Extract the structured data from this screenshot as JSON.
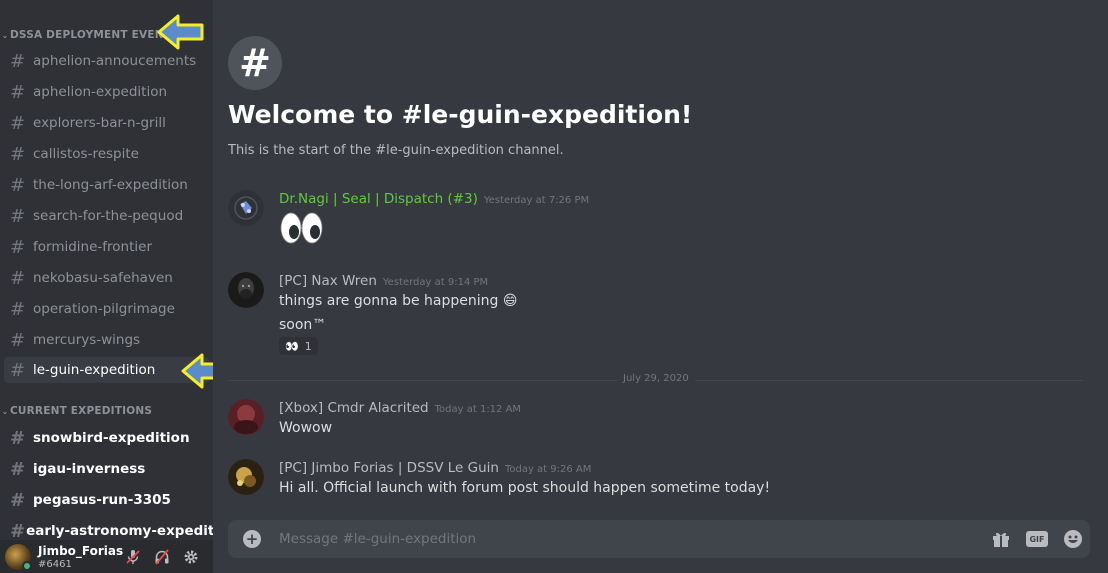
{
  "sidebar": {
    "categories": [
      {
        "name": "DSSA DEPLOYMENT EVENTS"
      },
      {
        "name": "CURRENT EXPEDITIONS"
      }
    ],
    "deployment_channels": [
      {
        "name": "aphelion-annoucements"
      },
      {
        "name": "aphelion-expedition"
      },
      {
        "name": "explorers-bar-n-grill"
      },
      {
        "name": "callistos-respite"
      },
      {
        "name": "the-long-arf-expedition"
      },
      {
        "name": "search-for-the-pequod"
      },
      {
        "name": "formidine-frontier"
      },
      {
        "name": "nekobasu-safehaven"
      },
      {
        "name": "operation-pilgrimage"
      },
      {
        "name": "mercurys-wings"
      },
      {
        "name": "le-guin-expedition"
      }
    ],
    "expedition_channels": [
      {
        "name": "snowbird-expedition"
      },
      {
        "name": "igau-inverness"
      },
      {
        "name": "pegasus-run-3305"
      },
      {
        "name": "early-astronomy-expedit"
      }
    ],
    "active_channel": "le-guin-expedition",
    "annotation_color": "#f5ee25"
  },
  "user_panel": {
    "name": "Jimbo_Forias",
    "tag": "#6461",
    "status_color": "#43b581",
    "icons": [
      "mic-muted-icon",
      "headphones-muted-icon",
      "gear-icon"
    ]
  },
  "channel_welcome": {
    "title": "Welcome to #le-guin-expedition!",
    "subtitle": "This is the start of the #le-guin-expedition channel."
  },
  "messages": [
    {
      "author": "Dr.Nagi | Seal | Dispatch (#3)",
      "author_color": "#5ecb3c",
      "timestamp": "Yesterday at 7:26 PM",
      "lines": [
        "👀"
      ]
    },
    {
      "author": "[PC] Nax Wren",
      "author_color": "#b9bbbe",
      "timestamp": "Yesterday at 9:14 PM",
      "lines": [
        "things are gonna be happening 😄",
        "soon™"
      ],
      "reaction": {
        "emoji": "👀",
        "count": "1"
      }
    },
    {
      "author": "[Xbox] Cmdr Alacrited",
      "author_color": "#b9bbbe",
      "timestamp": "Today at 1:12 AM",
      "lines": [
        "Wowow"
      ]
    },
    {
      "author": "[PC] Jimbo Forias | DSSV Le Guin",
      "author_color": "#b9bbbe",
      "timestamp": "Today at 9:26 AM",
      "lines": [
        "Hi all. Official launch with forum post should happen sometime today!"
      ]
    }
  ],
  "date_divider": "July 29, 2020",
  "composer": {
    "placeholder": "Message #le-guin-expedition",
    "gif_label": "GIF",
    "icons": [
      "add-icon",
      "gift-icon",
      "gif-icon",
      "emoji-icon"
    ]
  }
}
